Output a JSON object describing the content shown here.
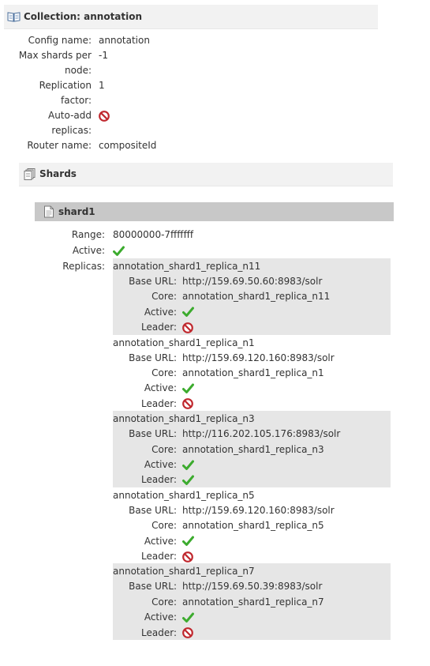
{
  "collection": {
    "title": "Collection: annotation",
    "properties": [
      {
        "label": "Config name:",
        "value": "annotation"
      },
      {
        "label": "Max shards per",
        "value": "-1"
      },
      {
        "label": "node:",
        "value": ""
      },
      {
        "label": "Replication",
        "value": "1"
      },
      {
        "label": "factor:",
        "value": ""
      },
      {
        "label": "Auto-add",
        "value": "",
        "icon": "disabled-icon"
      },
      {
        "label": "replicas:",
        "value": ""
      },
      {
        "label": "Router name:",
        "value": "compositeId"
      }
    ]
  },
  "shards": {
    "title": "Shards",
    "shard": {
      "name": "shard1",
      "range_label": "Range:",
      "range": "80000000-7fffffff",
      "active_label": "Active:",
      "active": true,
      "replicas_label": "Replicas:"
    }
  },
  "replica_labels": {
    "base_url": "Base URL:",
    "core": "Core:",
    "active": "Active:",
    "leader": "Leader:"
  },
  "replicas": [
    {
      "name": "annotation_shard1_replica_n11",
      "base_url": "http://159.69.50.60:8983/solr",
      "core": "annotation_shard1_replica_n11",
      "active": true,
      "leader": false
    },
    {
      "name": "annotation_shard1_replica_n1",
      "base_url": "http://159.69.120.160:8983/solr",
      "core": "annotation_shard1_replica_n1",
      "active": true,
      "leader": false
    },
    {
      "name": "annotation_shard1_replica_n3",
      "base_url": "http://116.202.105.176:8983/solr",
      "core": "annotation_shard1_replica_n3",
      "active": true,
      "leader": true
    },
    {
      "name": "annotation_shard1_replica_n5",
      "base_url": "http://159.69.120.160:8983/solr",
      "core": "annotation_shard1_replica_n5",
      "active": true,
      "leader": false
    },
    {
      "name": "annotation_shard1_replica_n7",
      "base_url": "http://159.69.50.39:8983/solr",
      "core": "annotation_shard1_replica_n7",
      "active": true,
      "leader": false
    }
  ],
  "colors": {
    "ok": "#3cab2e",
    "no": "#c0282e",
    "shaded_row": "#e6e6e6",
    "shard_header": "#c8c8c8"
  }
}
